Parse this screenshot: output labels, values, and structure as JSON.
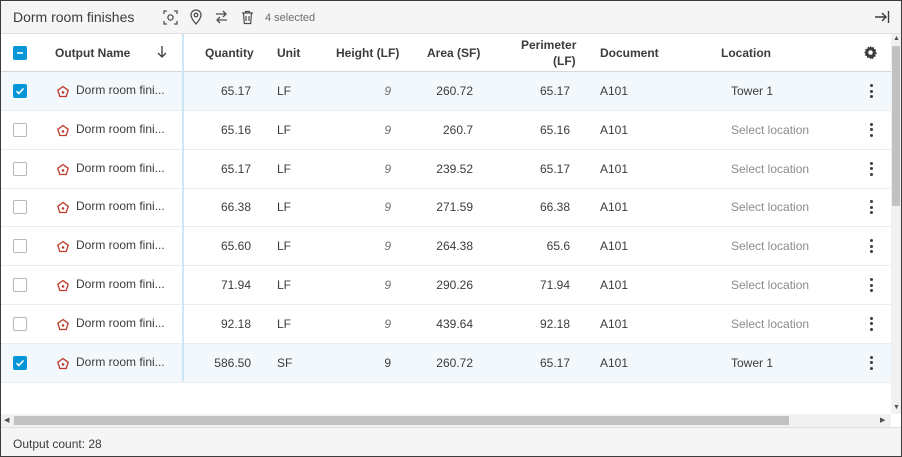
{
  "toolbar": {
    "title": "Dorm room finishes",
    "selected_text": "4 selected",
    "icons": [
      "screenshot-icon",
      "location-pin-icon",
      "swap-icon",
      "trash-icon",
      "collapse-panel-icon"
    ]
  },
  "header": {
    "output_name": "Output Name",
    "quantity": "Quantity",
    "unit": "Unit",
    "height": "Height (LF)",
    "area": "Area (SF)",
    "perimeter_line1": "Perimeter",
    "perimeter_line2": "(LF)",
    "document": "Document",
    "location": "Location"
  },
  "rows": [
    {
      "checked": true,
      "name": "Dorm room fini...",
      "quantity": "65.17",
      "unit": "LF",
      "height": "9",
      "area": "260.72",
      "perimeter": "65.17",
      "document": "A101",
      "location": "Tower 1",
      "location_set": true
    },
    {
      "checked": false,
      "name": "Dorm room fini...",
      "quantity": "65.16",
      "unit": "LF",
      "height": "9",
      "area": "260.7",
      "perimeter": "65.16",
      "document": "A101",
      "location": "Select location",
      "location_set": false
    },
    {
      "checked": false,
      "name": "Dorm room fini...",
      "quantity": "65.17",
      "unit": "LF",
      "height": "9",
      "area": "239.52",
      "perimeter": "65.17",
      "document": "A101",
      "location": "Select location",
      "location_set": false
    },
    {
      "checked": false,
      "name": "Dorm room fini...",
      "quantity": "66.38",
      "unit": "LF",
      "height": "9",
      "area": "271.59",
      "perimeter": "66.38",
      "document": "A101",
      "location": "Select location",
      "location_set": false
    },
    {
      "checked": false,
      "name": "Dorm room fini...",
      "quantity": "65.60",
      "unit": "LF",
      "height": "9",
      "area": "264.38",
      "perimeter": "65.6",
      "document": "A101",
      "location": "Select location",
      "location_set": false
    },
    {
      "checked": false,
      "name": "Dorm room fini...",
      "quantity": "71.94",
      "unit": "LF",
      "height": "9",
      "area": "290.26",
      "perimeter": "71.94",
      "document": "A101",
      "location": "Select location",
      "location_set": false
    },
    {
      "checked": false,
      "name": "Dorm room fini...",
      "quantity": "92.18",
      "unit": "LF",
      "height": "9",
      "area": "439.64",
      "perimeter": "92.18",
      "document": "A101",
      "location": "Select location",
      "location_set": false
    },
    {
      "checked": true,
      "name": "Dorm room fini...",
      "quantity": "586.50",
      "unit": "SF",
      "height": "9",
      "area": "260.72",
      "perimeter": "65.17",
      "document": "A101",
      "location": "Tower 1",
      "location_set": true,
      "height_plain": true
    }
  ],
  "footer": {
    "output_count": "Output count: 28"
  },
  "colors": {
    "accent": "#0696d7",
    "output_icon": "#c0392b",
    "selected_row": "#f2f8fc"
  }
}
